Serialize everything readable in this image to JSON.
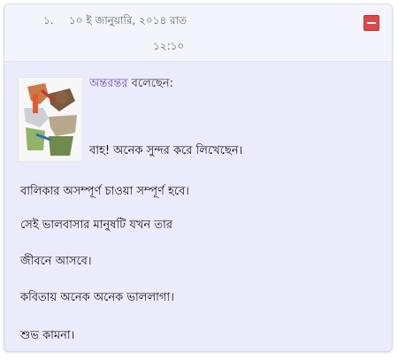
{
  "comment": {
    "number": "১.",
    "date": "১০ ই জানুয়ারি, ২০১৪ রাত",
    "time": "১২:১০",
    "author": "অন্তরন্তর",
    "said": "বলেছেন:",
    "lines": [
      "বাহ! অনেক সুন্দর করে লিখেছেন।",
      "বালিকার অসম্পূর্ণ চাওয়া সম্পূর্ণ হবে।",
      "সেই ভালবাসার মানুষটি যখন তার",
      "জীবনে আসবে।",
      "কবিতায় অনেক অনেক ভাললাগা।",
      "শুভ কামনা।"
    ]
  },
  "icons": {
    "report": "mail-icon"
  }
}
